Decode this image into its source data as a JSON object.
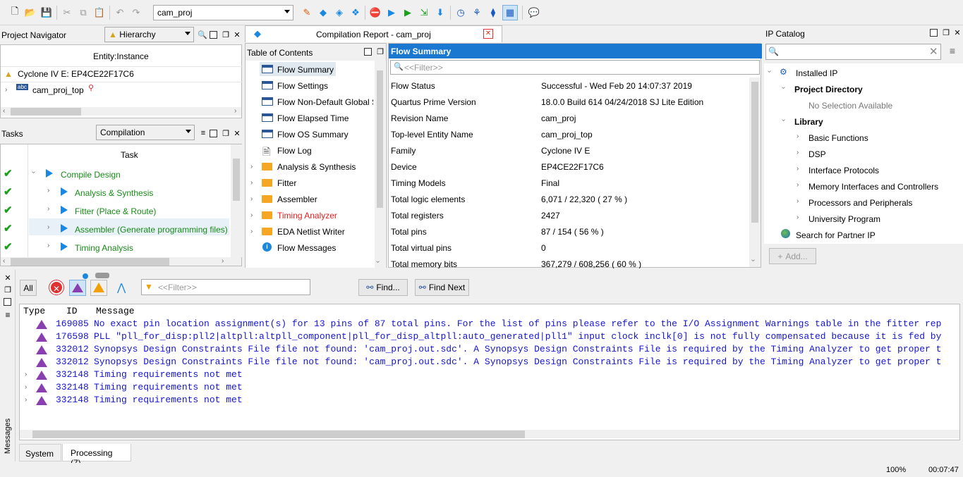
{
  "toolbar": {
    "project_combo": "cam_proj"
  },
  "project_navigator": {
    "title": "Project Navigator",
    "view": "Hierarchy",
    "column": "Entity:Instance",
    "device": "Cyclone IV E: EP4CE22F17C6",
    "top_entity": "cam_proj_top"
  },
  "tasks": {
    "title": "Tasks",
    "flow": "Compilation",
    "column": "Task",
    "items": [
      {
        "label": "Compile Design",
        "status": "done"
      },
      {
        "label": "Analysis & Synthesis",
        "status": "done"
      },
      {
        "label": "Fitter (Place & Route)",
        "status": "done"
      },
      {
        "label": "Assembler (Generate programming files)",
        "status": "done"
      },
      {
        "label": "Timing Analysis",
        "status": "done"
      }
    ]
  },
  "report": {
    "tab_title": "Compilation Report - cam_proj",
    "toc_title": "Table of Contents",
    "toc": [
      "Flow Summary",
      "Flow Settings",
      "Flow Non-Default Global S",
      "Flow Elapsed Time",
      "Flow OS Summary",
      "Flow Log",
      "Analysis & Synthesis",
      "Fitter",
      "Assembler",
      "Timing Analyzer",
      "EDA Netlist Writer",
      "Flow Messages"
    ],
    "summary_title": "Flow Summary",
    "filter_placeholder": "<<Filter>>",
    "rows": [
      {
        "k": "Flow Status",
        "v": "Successful - Wed Feb 20 14:07:37 2019"
      },
      {
        "k": "Quartus Prime Version",
        "v": "18.0.0 Build 614 04/24/2018 SJ Lite Edition"
      },
      {
        "k": "Revision Name",
        "v": "cam_proj"
      },
      {
        "k": "Top-level Entity Name",
        "v": "cam_proj_top"
      },
      {
        "k": "Family",
        "v": "Cyclone IV E"
      },
      {
        "k": "Device",
        "v": "EP4CE22F17C6"
      },
      {
        "k": "Timing Models",
        "v": "Final"
      },
      {
        "k": "Total logic elements",
        "v": "6,071 / 22,320 ( 27 % )"
      },
      {
        "k": "Total registers",
        "v": "2427"
      },
      {
        "k": "Total pins",
        "v": "87 / 154 ( 56 % )"
      },
      {
        "k": "Total virtual pins",
        "v": "0"
      },
      {
        "k": "Total memory bits",
        "v": "367,279 / 608,256 ( 60 % )"
      }
    ]
  },
  "ip_catalog": {
    "title": "IP Catalog",
    "installed": "Installed IP",
    "project_dir": "Project Directory",
    "no_selection": "No Selection Available",
    "library": "Library",
    "library_items": [
      "Basic Functions",
      "DSP",
      "Interface Protocols",
      "Memory Interfaces and Controllers",
      "Processors and Peripherals",
      "University Program"
    ],
    "partner": "Search for Partner IP",
    "add": "Add..."
  },
  "messages": {
    "all": "All",
    "filter_placeholder": "<<Filter>>",
    "find": "Find...",
    "find_next": "Find Next",
    "col_type": "Type",
    "col_id": "ID",
    "col_message": "Message",
    "side_label": "Messages",
    "rows": [
      {
        "id": "169085",
        "text": "No exact pin location assignment(s) for 13 pins of 87 total pins. For the list of pins please refer to the I/O Assignment Warnings table in the fitter rep"
      },
      {
        "id": "176598",
        "text": "PLL \"pll_for_disp:pll2|altpll:altpll_component|pll_for_disp_altpll:auto_generated|pll1\" input clock inclk[0] is not fully compensated because it is fed by"
      },
      {
        "id": "332012",
        "text": "Synopsys Design Constraints File file not found: 'cam_proj.out.sdc'. A Synopsys Design Constraints File is required by the Timing Analyzer to get proper t"
      },
      {
        "id": "332012",
        "text": "Synopsys Design Constraints File file not found: 'cam_proj.out.sdc'. A Synopsys Design Constraints File is required by the Timing Analyzer to get proper t"
      },
      {
        "id": "332148",
        "text": "Timing requirements not met"
      },
      {
        "id": "332148",
        "text": "Timing requirements not met"
      },
      {
        "id": "332148",
        "text": "Timing requirements not met"
      }
    ],
    "tabs": [
      "System",
      "Processing (7)"
    ]
  },
  "status": {
    "zoom": "100%",
    "time": "00:07:47"
  }
}
